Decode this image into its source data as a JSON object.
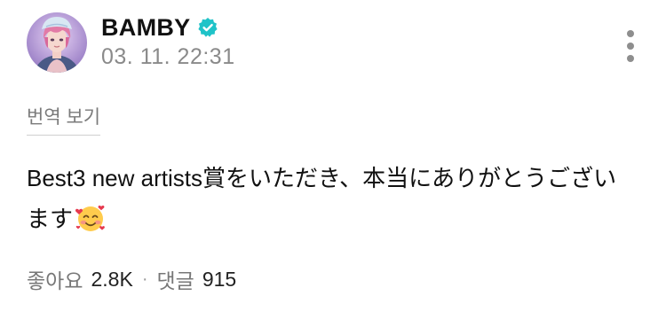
{
  "post": {
    "author": {
      "name": "BAMBY",
      "verified": true,
      "avatar": "avatar"
    },
    "timestamp": "03. 11. 22:31",
    "more_icon": "more-vertical-icon",
    "translate_label": "번역 보기",
    "body": "Best3 new artists賞をいただき、本当にありがとうございます",
    "emoji": "smiling-face-with-hearts-emoji",
    "stats": {
      "likes_label": "좋아요",
      "likes_value": "2.8K",
      "separator": "·",
      "comments_label": "댓글",
      "comments_value": "915"
    }
  },
  "colors": {
    "verified_badge": "#1fc3c8",
    "text_primary": "#111111",
    "text_secondary": "#8a8a8a",
    "background": "#ffffff"
  }
}
